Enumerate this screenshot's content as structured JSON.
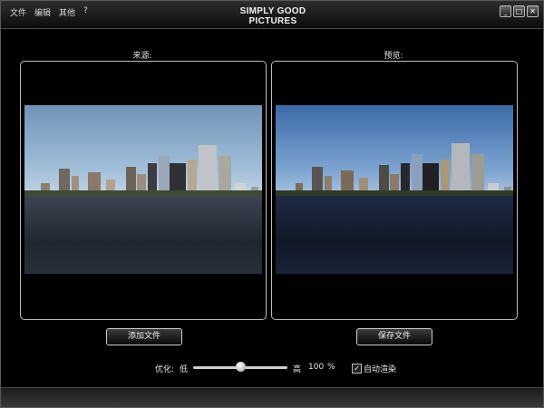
{
  "window": {
    "title": "SIMPLY GOOD PICTURES",
    "title_line1": "SIMPLY GOOD",
    "title_line2": "PICTURES",
    "menu": [
      "文件",
      "编辑",
      "其他",
      "?"
    ],
    "controls": {
      "minimize": "_",
      "maximize": "□",
      "close": "✕"
    }
  },
  "source_panel": {
    "label": "来源:"
  },
  "preview_panel": {
    "label": "预览:"
  },
  "actions": {
    "add_file": "添加文件",
    "save_file": "保存文件"
  },
  "optimize": {
    "label": "优化:",
    "low_label": "低",
    "high_label": "高",
    "value": "100",
    "unit": "%",
    "slider_fraction": 0.5,
    "auto_render_label": "自动渲染",
    "auto_render_checked": true,
    "check_glyph": "✓"
  },
  "colors": {
    "background": "#000000",
    "border": "#bdbdbd",
    "text": "#e6e6e6"
  }
}
